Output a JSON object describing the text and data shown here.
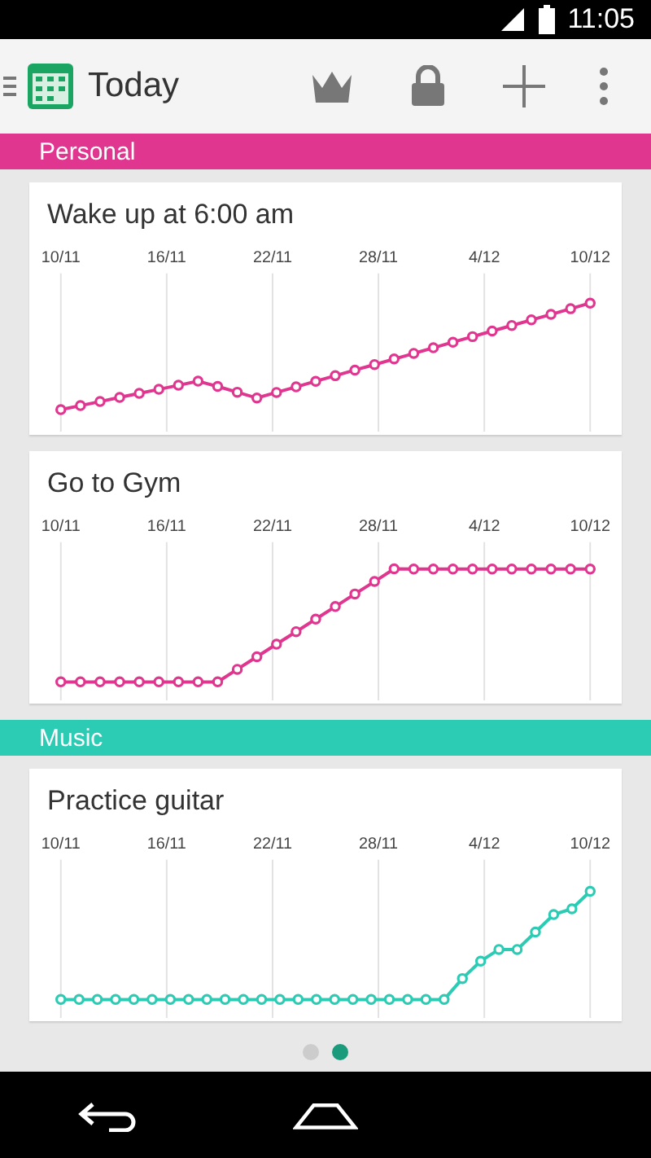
{
  "status_bar": {
    "time": "11:05"
  },
  "app_bar": {
    "title": "Today"
  },
  "sections": [
    {
      "name": "Personal",
      "color": "#e0368f",
      "habits": [
        {
          "title": "Wake up at 6:00 am",
          "x_labels": [
            "10/11",
            "16/11",
            "22/11",
            "28/11",
            "4/12",
            "10/12"
          ]
        },
        {
          "title": "Go to Gym",
          "x_labels": [
            "10/11",
            "16/11",
            "22/11",
            "28/11",
            "4/12",
            "10/12"
          ]
        }
      ]
    },
    {
      "name": "Music",
      "color": "#2ccbb4",
      "habits": [
        {
          "title": "Practice guitar",
          "x_labels": [
            "10/11",
            "16/11",
            "22/11",
            "28/11",
            "4/12",
            "10/12"
          ]
        }
      ]
    }
  ],
  "pages": [
    {
      "selected": false
    },
    {
      "selected": true
    }
  ]
}
